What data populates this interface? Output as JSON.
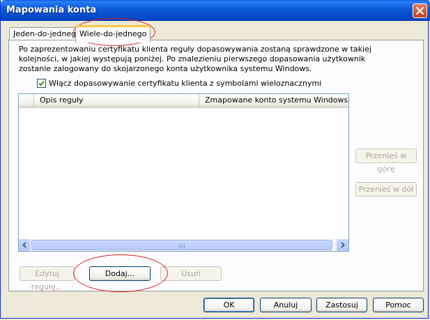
{
  "window": {
    "title": "Mapowania konta"
  },
  "tabs": [
    {
      "label": "Jeden-do-jednego",
      "active": false
    },
    {
      "label": "Wiele-do-jednego",
      "active": true
    }
  ],
  "panel": {
    "description": "Po zaprezentowaniu certyfikatu klienta reguły dopasowywania zostaną sprawdzone w takiej kolejności, w jakiej występują poniżej. Po znalezieniu pierwszego dopasowania użytkownik zostanie zalogowany do skojarzonego konta użytkownika systemu Windows.",
    "wildcard_checkbox": {
      "label": "Włącz dopasowywanie certyfikatu klienta z symbolami wieloznacznymi",
      "checked": true
    },
    "rules_table": {
      "columns": [
        "Opis reguły",
        "Zmapowane konto systemu Windows"
      ],
      "rows": []
    },
    "side_buttons": {
      "move_up": "Przenieś w górę",
      "move_down": "Przenieś w dół"
    },
    "rule_buttons": {
      "edit": "Edytuj regułę...",
      "add": "Dodaj...",
      "remove": "Usuń"
    }
  },
  "dialog_buttons": {
    "ok": "OK",
    "cancel": "Anuluj",
    "apply": "Zastosuj",
    "help": "Pomoc"
  },
  "colors": {
    "title_bar": "#0b5bd8",
    "tab_highlight": "#ffc83c",
    "annotation": "#dd2222"
  }
}
